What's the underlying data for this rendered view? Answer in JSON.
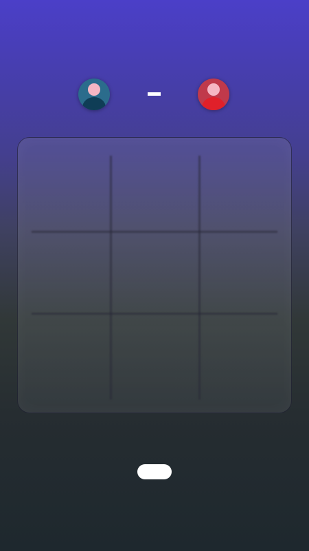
{
  "colors": {
    "background_top": "#4b3fc8",
    "background_bottom": "#1e282e",
    "player1_avatar": "#2b6c8c",
    "player2_avatar": "#c0394b",
    "score_separator": "#ffffff",
    "button": "#ffffff"
  },
  "scoreboard": {
    "player1": {
      "icon": "user-avatar-icon",
      "score": ""
    },
    "separator": "",
    "player2": {
      "icon": "user-avatar-icon",
      "score": ""
    }
  },
  "board": {
    "rows": 3,
    "cols": 3,
    "cells": [
      "",
      "",
      "",
      "",
      "",
      "",
      "",
      "",
      ""
    ]
  },
  "action_button": {
    "label": ""
  }
}
